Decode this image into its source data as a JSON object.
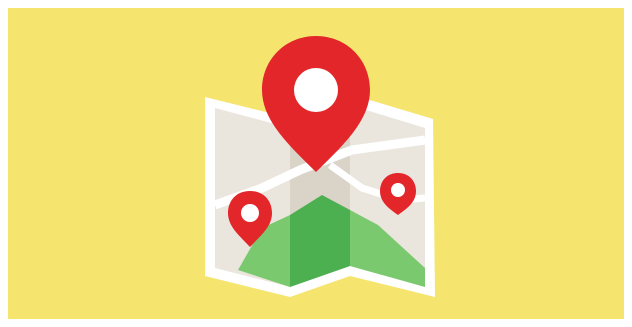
{
  "colors": {
    "background": "#f5e56e",
    "frame": "#ffffff",
    "map_paper_light": "#ebe6dd",
    "map_paper_dark": "#d9d3c8",
    "map_border": "#ffffff",
    "land_dark": "#4caf50",
    "land_light": "#7bc96f",
    "pin_red": "#e3262a"
  },
  "icons": {
    "main": "folded-map-with-location-pins"
  }
}
